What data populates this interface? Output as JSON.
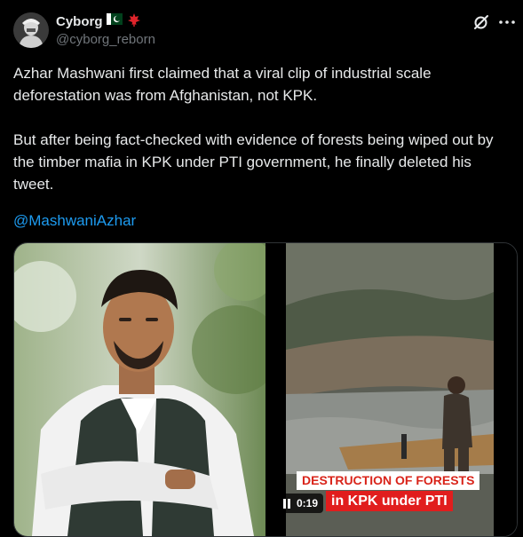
{
  "author": {
    "display_name": "Cyborg",
    "handle": "@cyborg_reborn",
    "flags": [
      "pakistan-flag",
      "canada-flag"
    ]
  },
  "header_icons": [
    "grok-icon",
    "more-options-icon"
  ],
  "tweet": {
    "paragraph1": "Azhar Mashwani first claimed that a viral clip of industrial scale deforestation was from Afghanistan, not KPK.",
    "paragraph2": "But after being fact-checked with evidence of forests being wiped out by the timber mafia in KPK under PTI government, he finally deleted his tweet.",
    "mention": "@MashwaniAzhar"
  },
  "video": {
    "caption_line1": "DESTRUCTION OF FORESTS",
    "caption_line2": "in KPK under PTI",
    "timestamp": "0:19",
    "state": "pause-icon"
  },
  "colors": {
    "background": "#000000",
    "text": "#e7e9ea",
    "secondary": "#71767b",
    "link": "#1d9bf0",
    "caption_red": "#e11d1d"
  }
}
